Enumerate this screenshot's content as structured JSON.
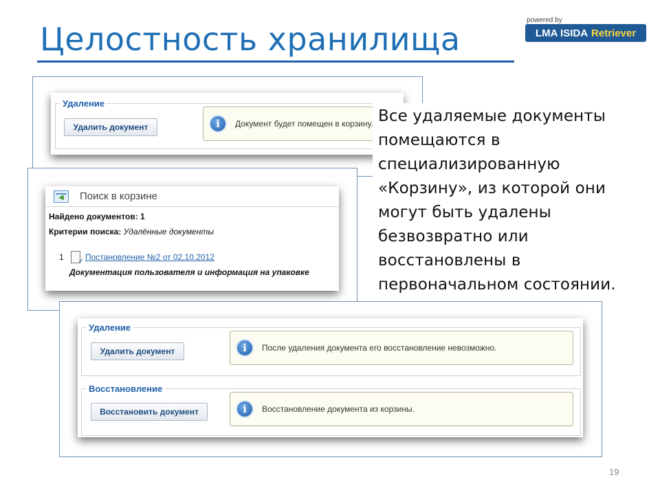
{
  "slide": {
    "title": "Целостность хранилища",
    "page_number": "19",
    "side_text": "Все удаляемые документы помещаются в специализированную «Корзину», из которой они могут быть удалены безвозвратно или восстановлены в первоначальном состоянии."
  },
  "logo": {
    "powered_by": "powered by",
    "brand": "LMA ISIDA",
    "product": "Retriever"
  },
  "shot1": {
    "legend": "Удаление",
    "button": "Удалить документ",
    "message": "Документ будет помещен в корзину."
  },
  "shot2": {
    "header": "Поиск в корзине",
    "found_label": "Найдено документов: 1",
    "criteria_label": "Критерии поиска:",
    "criteria_value": "Удалённые документы",
    "result_index": "1",
    "result_link": "Постановление №2 от 02.10.2012",
    "result_desc": "Документация пользователя и информация на упаковке"
  },
  "shot3": {
    "delete_legend": "Удаление",
    "delete_button": "Удалить документ",
    "delete_message": "После удаления документа его восстановление невозможно.",
    "restore_legend": "Восстановление",
    "restore_button": "Восстановить документ",
    "restore_message": "Восстановление документа из корзины."
  },
  "colors": {
    "title": "#1f6fb5",
    "accent": "#1f5fa8",
    "logo_bg": "#1f5a96",
    "logo_accent": "#ffd640"
  }
}
